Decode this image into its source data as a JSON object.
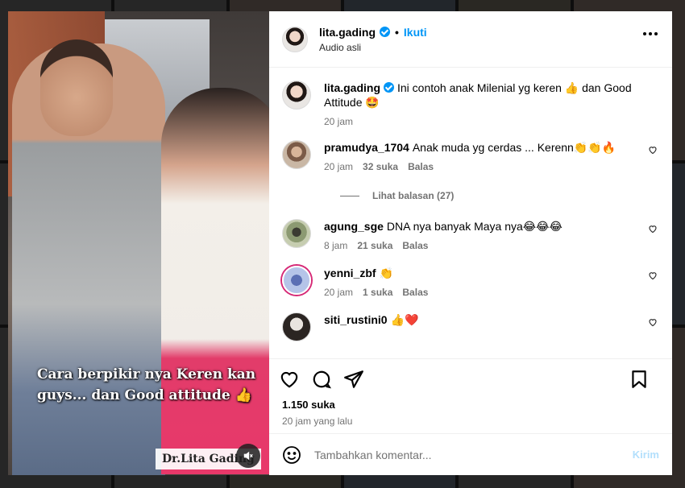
{
  "header": {
    "username": "lita.gading",
    "separator": "•",
    "follow_label": "Ikuti",
    "audio_label": "Audio asli"
  },
  "media": {
    "caption": "Cara berpikir nya Keren kan guys... dan Good attitude 👍",
    "watermark": "Dr.Lita Gading"
  },
  "caption_post": {
    "username": "lita.gading",
    "text": "Ini contoh anak Milenial yg keren 👍 dan Good Attitude 🤩",
    "time": "20 jam"
  },
  "comments": [
    {
      "username": "pramudya_1704",
      "text": "Anak muda yg cerdas ... Kerenn👏👏🔥",
      "time": "20 jam",
      "likes": "32 suka",
      "reply_label": "Balas"
    },
    {
      "username": "agung_sge",
      "text": "DNA nya banyak Maya nya😂😂😂",
      "time": "8 jam",
      "likes": "21 suka",
      "reply_label": "Balas"
    },
    {
      "username": "yenni_zbf",
      "text": "👏",
      "time": "20 jam",
      "likes": "1 suka",
      "reply_label": "Balas"
    },
    {
      "username": "siti_rustini0",
      "text": "👍❤️"
    }
  ],
  "view_replies_label": "Lihat balasan (27)",
  "stats": {
    "likes": "1.150 suka",
    "time_ago": "20 jam yang lalu"
  },
  "add_comment": {
    "placeholder": "Tambahkan komentar...",
    "post_label": "Kirim"
  },
  "colors": {
    "accent": "#0095f6",
    "post_disabled": "#b2dffc",
    "muted_text": "#737373"
  }
}
